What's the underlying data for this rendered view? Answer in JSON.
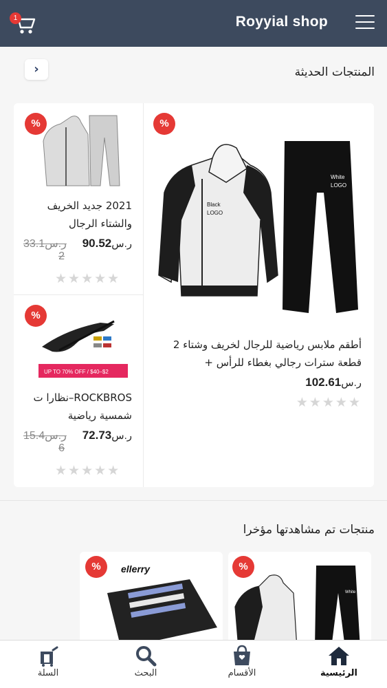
{
  "header": {
    "title": "Royyial shop",
    "cart_count": "1",
    "cart_icon": "cart-icon",
    "menu_icon": "hamburger-menu-icon"
  },
  "section_new": {
    "title": "المنتجات الحديثة",
    "next_icon": "chevron-right-icon",
    "next_label": "›"
  },
  "products": [
    {
      "name": "أطقم ملابس رياضية للرجال لخريف وشتاء 2 قطعة سترات رجالي بغطاء للرأس +",
      "price": "102.61",
      "currency": "ر.س",
      "old_price": "",
      "discount_badge": "%",
      "rating": 0,
      "image_labels": [
        "Black LOGO",
        "White LOGO"
      ]
    },
    {
      "name": "2021 جديد الخريف والشتاء الرجال",
      "price": "90.52",
      "currency": "ر.س",
      "old_price": "33.1ر.س 2",
      "discount_badge": "%",
      "rating": 0
    },
    {
      "name": "ROCKBROS–نظارا ت شمسية رياضية",
      "price": "72.73",
      "currency": "ر.س",
      "old_price": "15.4ر.س 6",
      "discount_badge": "%",
      "rating": 0,
      "image_banner": "UP TO 70% OFF / $40–$2"
    }
  ],
  "section_recent": {
    "title": "منتجات تم مشاهدتها مؤخرا",
    "items": [
      {
        "discount_badge": "%",
        "image_text": "White LOGO"
      },
      {
        "discount_badge": "%",
        "image_text": "ellerry"
      }
    ]
  },
  "bottom_nav": [
    {
      "label": "الرئيسية",
      "icon": "home-icon",
      "active": true
    },
    {
      "label": "الأقسام",
      "icon": "bag-icon",
      "active": false
    },
    {
      "label": "البحث",
      "icon": "search-icon",
      "active": false
    },
    {
      "label": "السلة",
      "icon": "cart-icon",
      "active": false
    }
  ],
  "colors": {
    "header": "#3d4a5e",
    "badge": "#e53935",
    "nav_icon": "#3d4a5e"
  }
}
